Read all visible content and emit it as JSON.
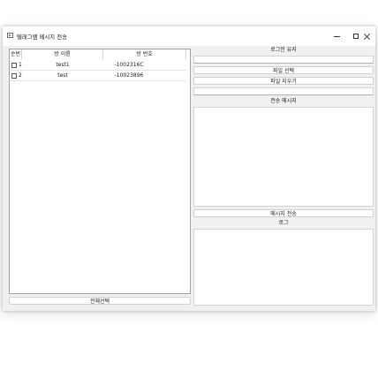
{
  "window": {
    "title": "텔레그램 메시지 전송"
  },
  "table": {
    "headers": [
      "순번",
      "방 이름",
      "방 번호"
    ],
    "rows": [
      {
        "index": "1",
        "room_name": "test1",
        "room_id": "-1002316C"
      },
      {
        "index": "2",
        "room_name": "test",
        "room_id": "-10023896"
      }
    ],
    "select_all_label": "전체선택"
  },
  "right_panel": {
    "login_keep_label": "로그인 유지",
    "file_select_label": "파일 선택",
    "file_clear_label": "파일 지우기",
    "message_label": "전송 메시지",
    "send_label": "메시지 전송",
    "log_label": "로그"
  }
}
